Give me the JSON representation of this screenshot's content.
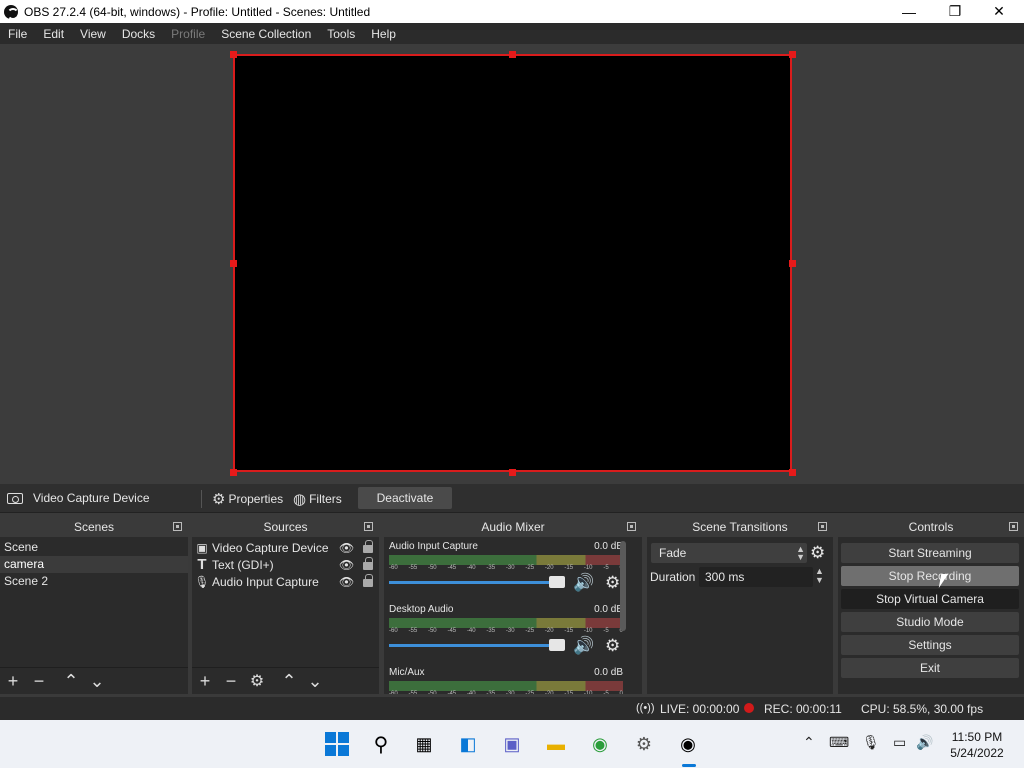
{
  "window": {
    "title": "OBS 27.2.4 (64-bit, windows) - Profile: Untitled - Scenes: Untitled",
    "minimize": "—",
    "maximize": "❐",
    "close": "✕"
  },
  "menu": [
    "File",
    "Edit",
    "View",
    "Docks",
    "Profile",
    "Scene Collection",
    "Tools",
    "Help"
  ],
  "source_toolbar": {
    "source_name": "Video Capture Device",
    "properties": "Properties",
    "filters": "Filters",
    "deactivate": "Deactivate"
  },
  "scenes": {
    "title": "Scenes",
    "items": [
      "Scene",
      "camera",
      "Scene 2"
    ],
    "selected": "camera"
  },
  "sources": {
    "title": "Sources",
    "items": [
      {
        "name": "Video Capture Device",
        "icon": "camera-icon"
      },
      {
        "name": "Text (GDI+)",
        "icon": "text-icon"
      },
      {
        "name": "Audio Input Capture",
        "icon": "microphone-icon"
      }
    ]
  },
  "audio_mixer": {
    "title": "Audio Mixer",
    "ticks": [
      "-60",
      "-55",
      "-50",
      "-45",
      "-40",
      "-35",
      "-30",
      "-25",
      "-20",
      "-15",
      "-10",
      "-5",
      "0"
    ],
    "channels": [
      {
        "name": "Audio Input Capture",
        "db": "0.0 dB"
      },
      {
        "name": "Desktop Audio",
        "db": "0.0 dB"
      },
      {
        "name": "Mic/Aux",
        "db": "0.0 dB"
      }
    ]
  },
  "transitions": {
    "title": "Scene Transitions",
    "selected": "Fade",
    "duration_label": "Duration",
    "duration_value": "300 ms"
  },
  "controls": {
    "title": "Controls",
    "start_streaming": "Start Streaming",
    "stop_recording": "Stop Recording",
    "stop_virtual_camera": "Stop Virtual Camera",
    "studio_mode": "Studio Mode",
    "settings": "Settings",
    "exit": "Exit"
  },
  "status": {
    "live": "LIVE: 00:00:00",
    "rec": "REC: 00:00:11",
    "cpu": "CPU: 58.5%, 30.00 fps"
  },
  "taskbar": {
    "time": "11:50 PM",
    "date": "5/24/2022"
  },
  "colors": {
    "accent": "#3d8fd9",
    "canvas_border": "#d91c1c",
    "rec_dot": "#d21a1a"
  }
}
